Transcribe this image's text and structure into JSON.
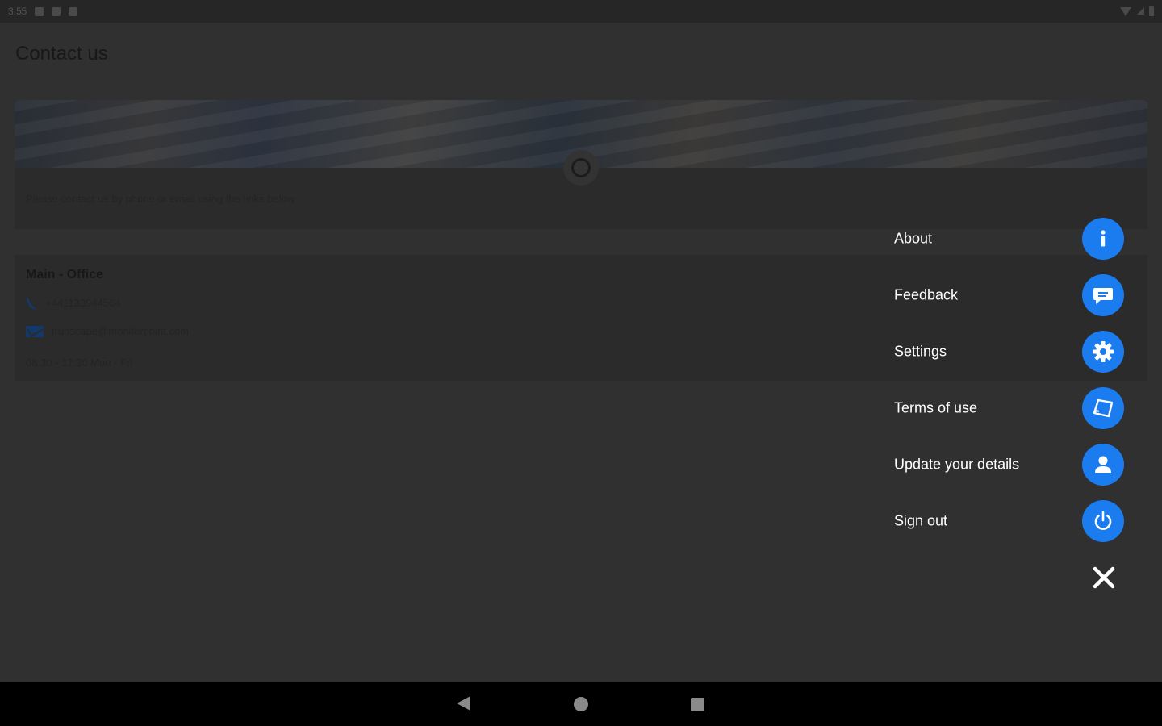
{
  "status_bar": {
    "time": "3:55"
  },
  "page": {
    "title": "Contact us",
    "intro": "Please contact us by phone or email using the links below",
    "office": {
      "name": "Main - Office",
      "phone": "+441133944564",
      "email": "trunscape@monitorpoint.com",
      "hours": "08:30 - 17:30 Mon - Fri"
    }
  },
  "menu": {
    "items": [
      {
        "label": "About",
        "icon": "info-icon"
      },
      {
        "label": "Feedback",
        "icon": "chat-icon"
      },
      {
        "label": "Settings",
        "icon": "gear-icon"
      },
      {
        "label": "Terms of use",
        "icon": "document-icon"
      },
      {
        "label": "Update your details",
        "icon": "person-icon"
      },
      {
        "label": "Sign out",
        "icon": "power-icon"
      }
    ],
    "close_icon": "close-icon",
    "accent_color": "#1b7cf0"
  },
  "nav_bar": {
    "back_icon": "back-icon",
    "home_icon": "home-icon",
    "recent_icon": "recents-icon"
  }
}
